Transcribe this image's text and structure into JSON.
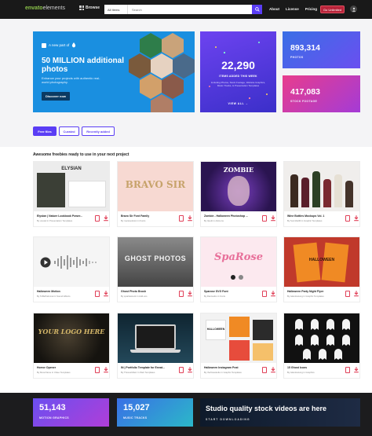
{
  "topbar": {
    "brand_strong": "envato",
    "brand_light": "elements",
    "browse_label": "Browse",
    "category_value": "All Items",
    "search_placeholder": "Search",
    "nav": [
      "About",
      "License",
      "Pricing"
    ],
    "unlimited_label": "Go Unlimited"
  },
  "hero": {
    "main": {
      "logo_text": "A new part of",
      "title": "50 MILLION additional photos",
      "subtitle": "Enhance your projects with authentic real-world photography.",
      "cta": "Discover now"
    },
    "mid": {
      "number": "22,290",
      "caption": "ITEMS ADDED THIS WEEK",
      "sub": "Including Photos, Stock Footage, Website Graphics, Music Tracks, & Presentation Templates",
      "link": "VIEW ALL →"
    },
    "photos": {
      "number": "893,314",
      "caption": "PHOTOS"
    },
    "footage": {
      "number": "417,083",
      "caption": "STOCK FOOTAGE"
    }
  },
  "tabs": [
    "Free files",
    "Curated",
    "Recently added"
  ],
  "section_title": "Awesome freebies ready to use in your next project",
  "cards": [
    {
      "title": "Elysian | Nature Lookbook Power...",
      "meta": "By unelek in Presentation Templates",
      "thumb_text": "ELYSIAN"
    },
    {
      "title": "Bravo Sir Font Family",
      "meta": "By mariosolution in Fonts",
      "thumb_text": "BRAVO SIR"
    },
    {
      "title": "Zombie - Halloween Photoshop ...",
      "meta": "By 3petti in Add-ons",
      "thumb_text": "ZOMBIE"
    },
    {
      "title": "Wine Bottles Mockups Vol. 1",
      "meta": "By SunnDelRi in Graphic Templates",
      "thumb_text": ""
    },
    {
      "title": "Halloween Motion",
      "meta": "By ToBePalmmat in Sound Effects",
      "thumb_text": ""
    },
    {
      "title": "Ghost Photo Brush",
      "meta": "By sparklestock in Add-ons",
      "thumb_text": "GHOST PHOTOS"
    },
    {
      "title": "Sparose SVG Font",
      "meta": "By illanisudio in Fonts",
      "thumb_text": "SpaRose"
    },
    {
      "title": "Halloween Party Night Flyer",
      "meta": "By islandsotong in Graphic Templates",
      "thumb_text": "HALLOWEEN"
    },
    {
      "title": "Horror Opener",
      "meta": "By Moonframe in Video Templates",
      "thumb_text": "YOUR LOGO HERE"
    },
    {
      "title": "IN | Portfolio Template for Envat...",
      "meta": "By TheworkDetz in Web Templates",
      "thumb_text": ""
    },
    {
      "title": "Halloween Instagram Post",
      "meta": "By thefrstestudio in Graphic Templates",
      "thumb_text": "HALLOWEEN"
    },
    {
      "title": "15 Ghost Icons",
      "meta": "By islandsotong in Graphics",
      "thumb_text": ""
    }
  ],
  "bottom": {
    "motion": {
      "number": "51,143",
      "caption": "MOTION GRAPHICS"
    },
    "music": {
      "number": "15,027",
      "caption": "MUSIC TRACKS"
    },
    "promo": {
      "title": "Studio quality stock videos are here",
      "sub": "START DOWNLOADING"
    }
  },
  "colors": {
    "topbar": "#191919",
    "accent": "#5a3df5",
    "brand": "#8bc34a",
    "hero_blue": "#1a8fe0",
    "hero_purple": "#6d43f0",
    "pink": "#e83d8d",
    "download_red": "#e04058"
  },
  "icons": [
    "grid-icon",
    "search-icon",
    "user-icon",
    "bookmark-icon",
    "download-icon"
  ]
}
